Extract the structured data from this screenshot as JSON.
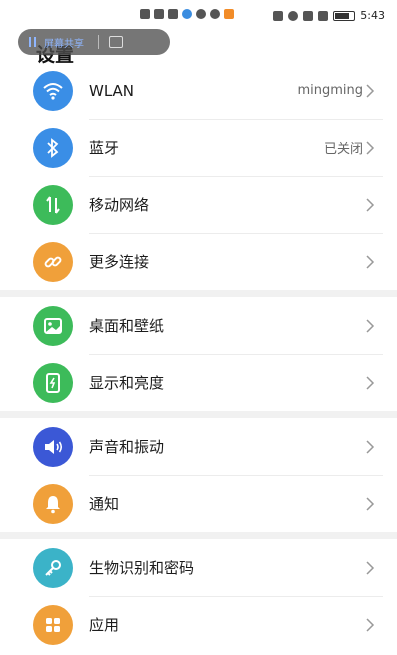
{
  "status_bar": {
    "time": "5:43",
    "icons": [
      "hd-icon",
      "signal-icon",
      "wifi-icon",
      "notification-icon",
      "vpn-icon",
      "heart-icon",
      "app-icon",
      "cast-icon",
      "eye-icon",
      "nfc-icon",
      "mute-icon",
      "battery-icon"
    ]
  },
  "header": {
    "title": "设置"
  },
  "floating_pill": {
    "text": "屏幕共享",
    "icon": "exit-icon"
  },
  "colors": {
    "blue": "#3a8ee6",
    "green": "#3dbb5a",
    "orange": "#f0a03a",
    "indigo": "#3b58d6",
    "teal": "#3bb3c8"
  },
  "sections": [
    {
      "items": [
        {
          "label": "WLAN",
          "value": "mingming",
          "icon": "wifi-icon",
          "color": "#3a8ee6"
        },
        {
          "label": "蓝牙",
          "value": "已关闭",
          "icon": "bluetooth-icon",
          "color": "#3a8ee6"
        },
        {
          "label": "移动网络",
          "value": "",
          "icon": "mobile-data-icon",
          "color": "#3dbb5a"
        },
        {
          "label": "更多连接",
          "value": "",
          "icon": "link-icon",
          "color": "#f0a03a"
        }
      ]
    },
    {
      "items": [
        {
          "label": "桌面和壁纸",
          "value": "",
          "icon": "image-icon",
          "color": "#3dbb5a"
        },
        {
          "label": "显示和亮度",
          "value": "",
          "icon": "display-icon",
          "color": "#3dbb5a"
        }
      ]
    },
    {
      "items": [
        {
          "label": "声音和振动",
          "value": "",
          "icon": "speaker-icon",
          "color": "#3b58d6"
        },
        {
          "label": "通知",
          "value": "",
          "icon": "bell-icon",
          "color": "#f0a03a"
        }
      ]
    },
    {
      "items": [
        {
          "label": "生物识别和密码",
          "value": "",
          "icon": "key-icon",
          "color": "#3bb3c8"
        },
        {
          "label": "应用",
          "value": "",
          "icon": "apps-grid-icon",
          "color": "#f0a03a"
        }
      ]
    }
  ]
}
